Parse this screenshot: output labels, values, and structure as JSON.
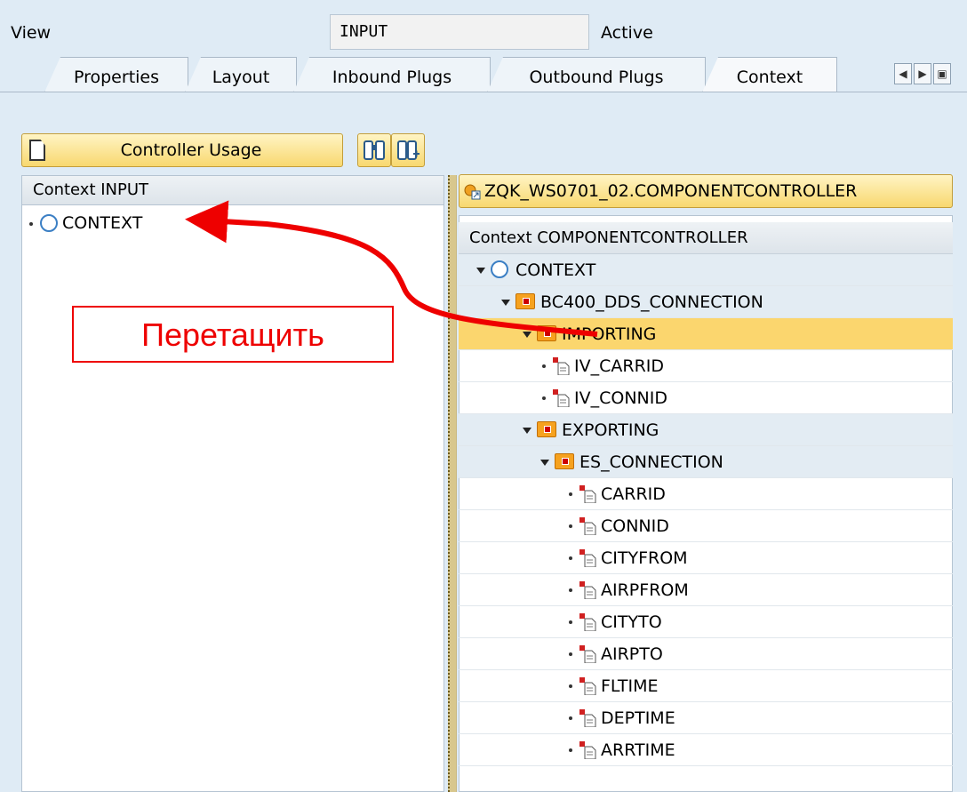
{
  "header": {
    "view_label": "View",
    "view_value": "INPUT",
    "status": "Active"
  },
  "tabs": [
    {
      "label": "Properties",
      "active": false
    },
    {
      "label": "Layout",
      "active": false
    },
    {
      "label": "Inbound Plugs",
      "active": false
    },
    {
      "label": "Outbound Plugs",
      "active": false
    },
    {
      "label": "Context",
      "active": true
    }
  ],
  "toolbar": {
    "controller_usage_label": "Controller Usage"
  },
  "left": {
    "title": "Context INPUT",
    "root": "CONTEXT"
  },
  "right": {
    "controller_button": "ZQK_WS0701_02.COMPONENTCONTROLLER",
    "title": "Context COMPONENTCONTROLLER",
    "tree": [
      {
        "label": "CONTEXT",
        "kind": "root",
        "level": 0
      },
      {
        "label": "BC400_DDS_CONNECTION",
        "kind": "node",
        "level": 1
      },
      {
        "label": "IMPORTING",
        "kind": "node",
        "level": 2,
        "selected": true
      },
      {
        "label": "IV_CARRID",
        "kind": "attr",
        "level": 3
      },
      {
        "label": "IV_CONNID",
        "kind": "attr",
        "level": 3
      },
      {
        "label": "EXPORTING",
        "kind": "node",
        "level": 2
      },
      {
        "label": "ES_CONNECTION",
        "kind": "node",
        "level": 3
      },
      {
        "label": "CARRID",
        "kind": "attr",
        "level": 4
      },
      {
        "label": "CONNID",
        "kind": "attr",
        "level": 4
      },
      {
        "label": "CITYFROM",
        "kind": "attr",
        "level": 4
      },
      {
        "label": "AIRPFROM",
        "kind": "attr",
        "level": 4
      },
      {
        "label": "CITYTO",
        "kind": "attr",
        "level": 4
      },
      {
        "label": "AIRPTO",
        "kind": "attr",
        "level": 4
      },
      {
        "label": "FLTIME",
        "kind": "attr",
        "level": 4
      },
      {
        "label": "DEPTIME",
        "kind": "attr",
        "level": 4
      },
      {
        "label": "ARRTIME",
        "kind": "attr",
        "level": 4
      }
    ]
  },
  "annotation": {
    "text": "Перетащить"
  },
  "colors": {
    "selection": "#fbd66e",
    "arrow": "#ee0000",
    "background": "#dfebf5"
  }
}
